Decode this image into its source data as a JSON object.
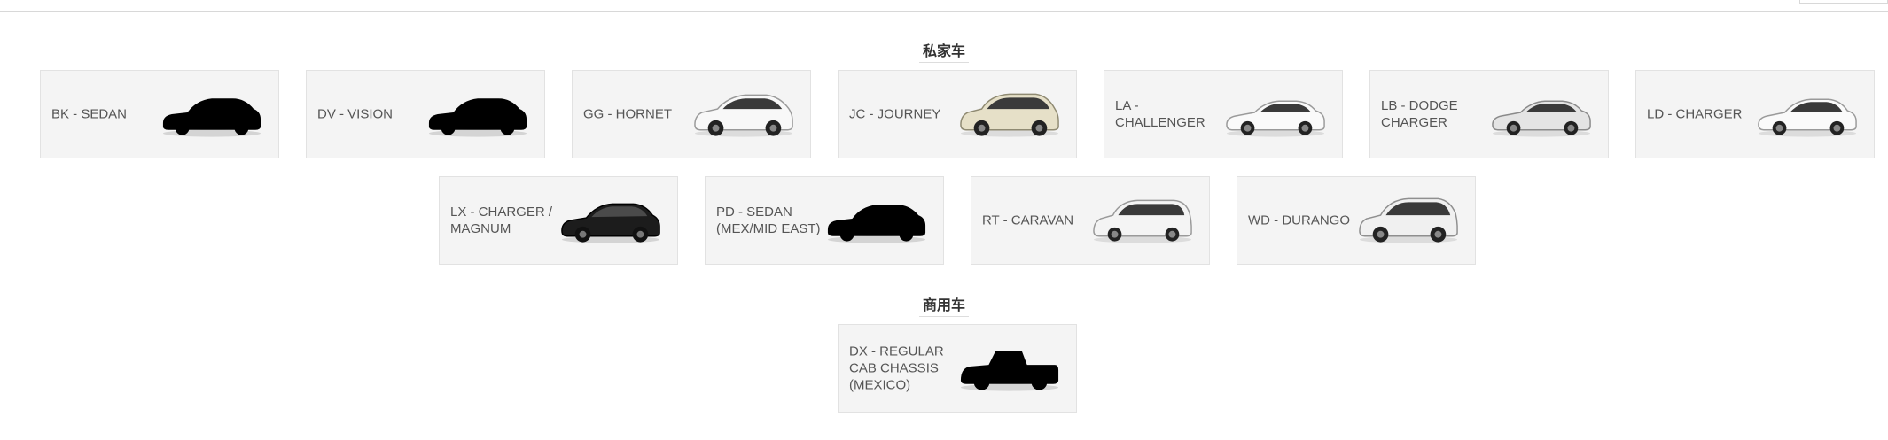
{
  "sections": [
    {
      "title": "私家车",
      "cards": [
        {
          "label": "BK - SEDAN",
          "image": "car-silhouette-placeholder"
        },
        {
          "label": "DV - VISION",
          "image": "car-silhouette-placeholder"
        },
        {
          "label": "GG - HORNET",
          "image": "white-suv"
        },
        {
          "label": "JC - JOURNEY",
          "image": "beige-crossover"
        },
        {
          "label": "LA - CHALLENGER",
          "image": "white-coupe"
        },
        {
          "label": "LB - DODGE CHARGER",
          "image": "silver-coupe"
        },
        {
          "label": "LD - CHARGER",
          "image": "white-sedan"
        },
        {
          "label": "LX - CHARGER / MAGNUM",
          "image": "black-sedan"
        },
        {
          "label": "PD - SEDAN (MEX/MID EAST)",
          "image": "car-silhouette-placeholder"
        },
        {
          "label": "RT - CARAVAN",
          "image": "white-minivan"
        },
        {
          "label": "WD - DURANGO",
          "image": "white-suv"
        }
      ]
    },
    {
      "title": "商用车",
      "cards": [
        {
          "label": "DX - REGULAR CAB CHASSIS (MEXICO)",
          "image": "truck-silhouette-placeholder"
        }
      ]
    }
  ]
}
